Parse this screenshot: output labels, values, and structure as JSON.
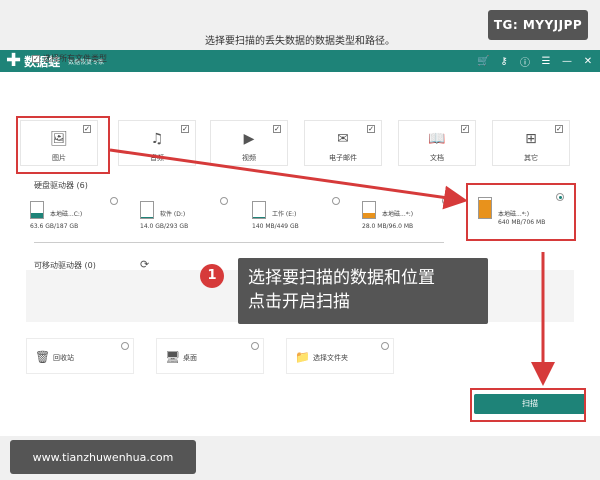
{
  "watermark_top": "TG: MYYJJPP",
  "watermark_bottom": "www.tianzhuwenhua.com",
  "app": {
    "logo": "数据蛙",
    "subtitle": "数据恢复专家",
    "heading": "选择要扫描的丢失数据的数据类型和路径。"
  },
  "select_all": {
    "label": "选择所有文件类型",
    "checked": true
  },
  "file_types": [
    {
      "label": "图片",
      "icon": "image-icon",
      "checked": true
    },
    {
      "label": "音频",
      "icon": "audio-icon",
      "checked": true
    },
    {
      "label": "视频",
      "icon": "video-icon",
      "checked": true
    },
    {
      "label": "电子邮件",
      "icon": "email-icon",
      "checked": true
    },
    {
      "label": "文档",
      "icon": "document-icon",
      "checked": true
    },
    {
      "label": "其它",
      "icon": "other-icon",
      "checked": true
    }
  ],
  "hard_drives": {
    "title": "硬盘驱动器",
    "count": "(6)",
    "items": [
      {
        "name": "本地磁...C:)",
        "size": "63.6 GB/187 GB",
        "usage": 0.34,
        "selected": false
      },
      {
        "name": "软件 (D:)",
        "size": "14.0 GB/293 GB",
        "usage": 0.05,
        "selected": false
      },
      {
        "name": "工作 (E:)",
        "size": "140 MB/449 GB",
        "usage": 0.01,
        "selected": false
      },
      {
        "name": "本地磁...*:)",
        "size": "28.0 MB/96.0 MB",
        "usage": 0.29,
        "selected": false
      },
      {
        "name": "本地磁...*:)",
        "size": "640 MB/706 MB",
        "usage": 0.91,
        "selected": true
      }
    ]
  },
  "removable": {
    "title": "可移动驱动器",
    "count": "(0)"
  },
  "locations": [
    {
      "label": "回收站",
      "icon": "recycle-bin-icon"
    },
    {
      "label": "桌面",
      "icon": "desktop-icon"
    },
    {
      "label": "选择文件夹",
      "icon": "folder-icon"
    }
  ],
  "scan_button": "扫描",
  "tooltip": {
    "step": "1",
    "line1": "选择要扫描的数据和位置",
    "line2": "点击开启扫描"
  },
  "colors": {
    "accent": "#1e8378",
    "annotation_red": "#d63a3a",
    "drive_fill_orange": "#e8921c"
  }
}
